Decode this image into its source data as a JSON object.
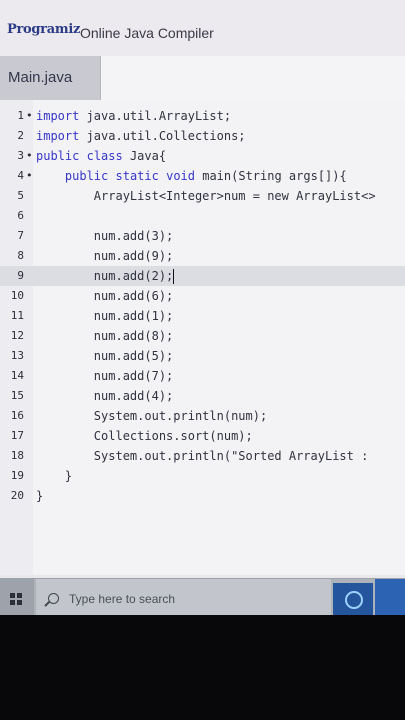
{
  "header": {
    "logo_text": "Programiz",
    "title": "Online Java Compiler"
  },
  "tabs": {
    "active_file": "Main.java"
  },
  "editor": {
    "active_line": 9,
    "lines": [
      {
        "num": "1",
        "fold": "•",
        "code": "import java.util.ArrayList;"
      },
      {
        "num": "2",
        "fold": "",
        "code": "import java.util.Collections;"
      },
      {
        "num": "3",
        "fold": "•",
        "code": "public class Java{"
      },
      {
        "num": "4",
        "fold": "•",
        "code": "    public static void main(String args[]){"
      },
      {
        "num": "5",
        "fold": "",
        "code": "        ArrayList<Integer>num = new ArrayList<>"
      },
      {
        "num": "6",
        "fold": "",
        "code": ""
      },
      {
        "num": "7",
        "fold": "",
        "code": "        num.add(3);"
      },
      {
        "num": "8",
        "fold": "",
        "code": "        num.add(9);"
      },
      {
        "num": "9",
        "fold": "",
        "code": "        num.add(2);"
      },
      {
        "num": "10",
        "fold": "",
        "code": "        num.add(6);"
      },
      {
        "num": "11",
        "fold": "",
        "code": "        num.add(1);"
      },
      {
        "num": "12",
        "fold": "",
        "code": "        num.add(8);"
      },
      {
        "num": "13",
        "fold": "",
        "code": "        num.add(5);"
      },
      {
        "num": "14",
        "fold": "",
        "code": "        num.add(7);"
      },
      {
        "num": "15",
        "fold": "",
        "code": "        num.add(4);"
      },
      {
        "num": "16",
        "fold": "",
        "code": "        System.out.println(num);"
      },
      {
        "num": "17",
        "fold": "",
        "code": "        Collections.sort(num);"
      },
      {
        "num": "18",
        "fold": "",
        "code": "        System.out.println(\"Sorted ArrayList :"
      },
      {
        "num": "19",
        "fold": "",
        "code": "    }"
      },
      {
        "num": "20",
        "fold": "",
        "code": "}"
      }
    ]
  },
  "taskbar": {
    "search_placeholder": "Type here to search",
    "icons": [
      "windows-start-icon",
      "search-icon",
      "edge-browser-icon"
    ]
  },
  "colors": {
    "keyword": "#3636c8",
    "logo": "#2b3b86",
    "active_line": "#dcdce3"
  }
}
